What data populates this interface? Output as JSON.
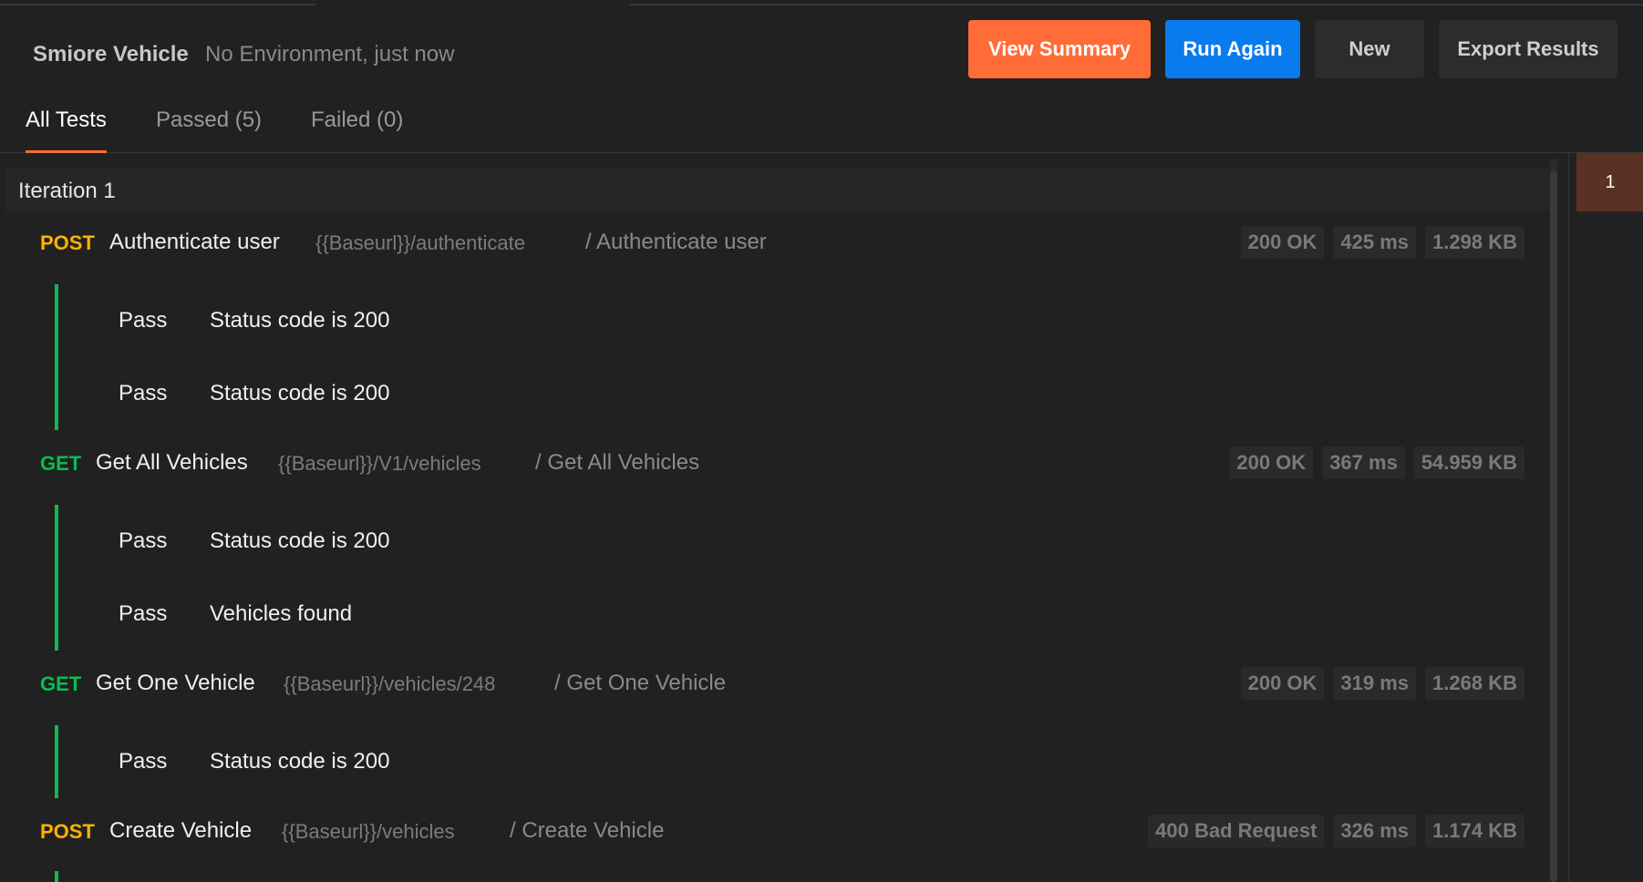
{
  "header": {
    "collection_name": "Smiore Vehicle",
    "run_meta": "No Environment, just now",
    "buttons": {
      "view_summary": "View Summary",
      "run_again": "Run Again",
      "new": "New",
      "export_results": "Export Results"
    }
  },
  "colors": {
    "accent_orange": "#ff6c37",
    "primary_blue": "#097bed",
    "method_post": "#ffb400",
    "method_get": "#0cbb52",
    "pass_green": "#0cbb52"
  },
  "tabs": [
    {
      "label": "All Tests",
      "active": true
    },
    {
      "label": "Passed (5)",
      "active": false
    },
    {
      "label": "Failed (0)",
      "active": false
    }
  ],
  "iteration": {
    "label": "Iteration 1",
    "nav_number": "1"
  },
  "requests": [
    {
      "method": "POST",
      "name": "Authenticate user",
      "url": "{{Baseurl}}/authenticate",
      "path": "/ Authenticate user",
      "status": "200 OK",
      "time": "425 ms",
      "size": "1.298 KB",
      "tests": [
        {
          "status": "Pass",
          "name": "Status code is 200"
        },
        {
          "status": "Pass",
          "name": "Status code is 200"
        }
      ]
    },
    {
      "method": "GET",
      "name": "Get All Vehicles",
      "url": "{{Baseurl}}/V1/vehicles",
      "path": "/ Get All Vehicles",
      "status": "200 OK",
      "time": "367 ms",
      "size": "54.959 KB",
      "tests": [
        {
          "status": "Pass",
          "name": "Status code is 200"
        },
        {
          "status": "Pass",
          "name": "Vehicles found"
        }
      ]
    },
    {
      "method": "GET",
      "name": "Get One Vehicle",
      "url": "{{Baseurl}}/vehicles/248",
      "path": "/ Get One Vehicle",
      "status": "200 OK",
      "time": "319 ms",
      "size": "1.268 KB",
      "tests": [
        {
          "status": "Pass",
          "name": "Status code is 200"
        }
      ]
    },
    {
      "method": "POST",
      "name": "Create Vehicle",
      "url": "{{Baseurl}}/vehicles",
      "path": "/ Create Vehicle",
      "status": "400 Bad Request",
      "time": "326 ms",
      "size": "1.174 KB",
      "tests": []
    }
  ]
}
